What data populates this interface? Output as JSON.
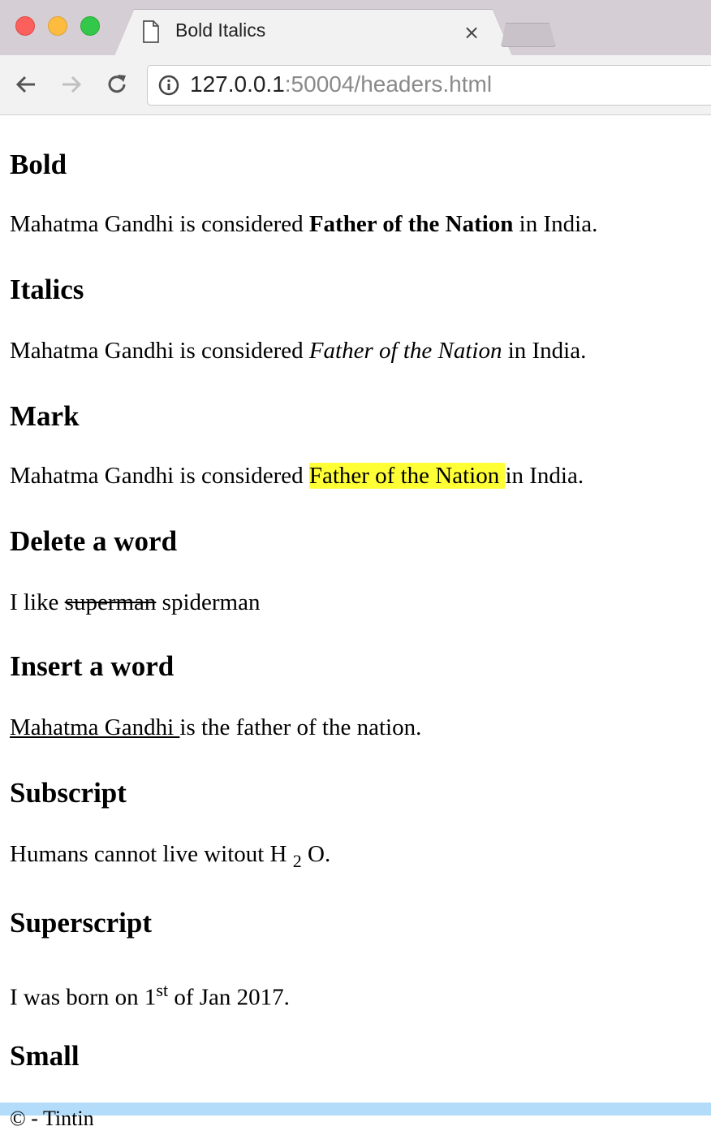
{
  "browser": {
    "tab_title": "Bold Italics",
    "tab_close": "×",
    "url_host": "127.0.0.1",
    "url_rest": ":50004/headers.html"
  },
  "sections": {
    "bold": {
      "heading": "Bold",
      "before": "Mahatma Gandhi is considered ",
      "emphasis": "Father of the Nation",
      "after": " in India."
    },
    "italics": {
      "heading": "Italics",
      "before": "Mahatma Gandhi is considered ",
      "emphasis": "Father of the Nation",
      "after": " in India."
    },
    "mark": {
      "heading": "Mark",
      "before": "Mahatma Gandhi is considered ",
      "emphasis": "Father of the Nation ",
      "after": "in India.",
      "highlight_color": "#ffff36"
    },
    "delete": {
      "heading": "Delete a word",
      "before": "I like ",
      "deleted": "superman",
      "after": " spiderman"
    },
    "insert": {
      "heading": "Insert a word",
      "inserted": "Mahatma Gandhi ",
      "after": "is the father of the nation."
    },
    "subscript": {
      "heading": "Subscript",
      "before": "Humans cannot live witout H ",
      "sub": "2",
      "after": " O."
    },
    "superscript": {
      "heading": "Superscript",
      "before": "I was born on 1",
      "sup": "st",
      "after": " of Jan 2017."
    },
    "small": {
      "heading": "Small"
    }
  },
  "footer": {
    "text": "© - Tintin",
    "bar_color": "#b3dcfa"
  }
}
